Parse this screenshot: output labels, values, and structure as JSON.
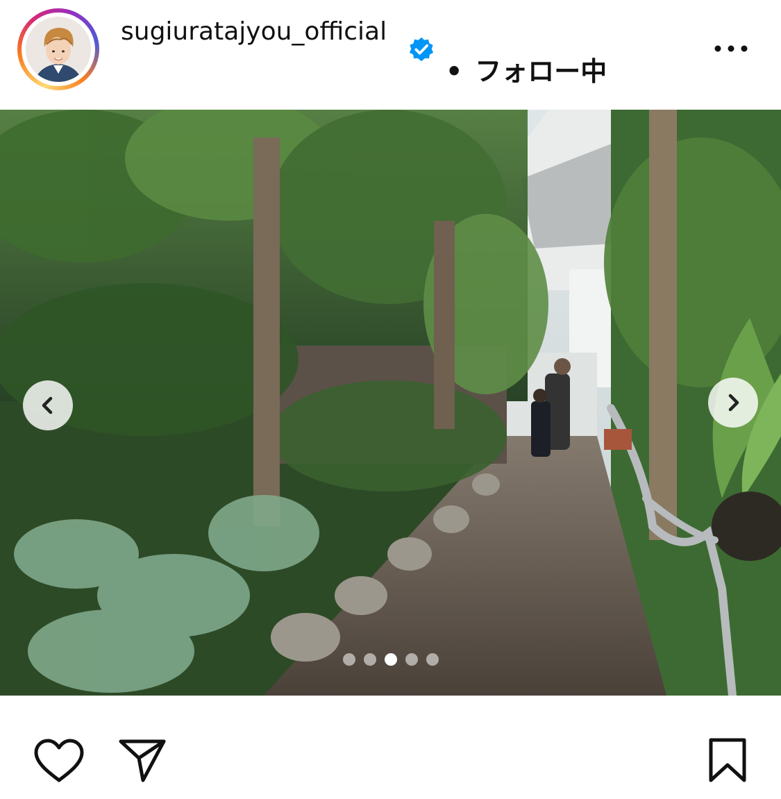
{
  "post": {
    "username": "sugiuratajyou_official",
    "follow_separator": "•",
    "follow_label": "フォロー中"
  },
  "carousel": {
    "total_slides": 5,
    "active_index": 2
  },
  "icons": {
    "verified": "verified-badge-icon",
    "more": "more-options-icon",
    "prev": "chevron-left-icon",
    "next": "chevron-right-icon",
    "like": "heart-icon",
    "share": "paper-plane-icon",
    "save": "bookmark-icon"
  },
  "colors": {
    "verified_blue": "#0095f6",
    "text": "#111111"
  }
}
